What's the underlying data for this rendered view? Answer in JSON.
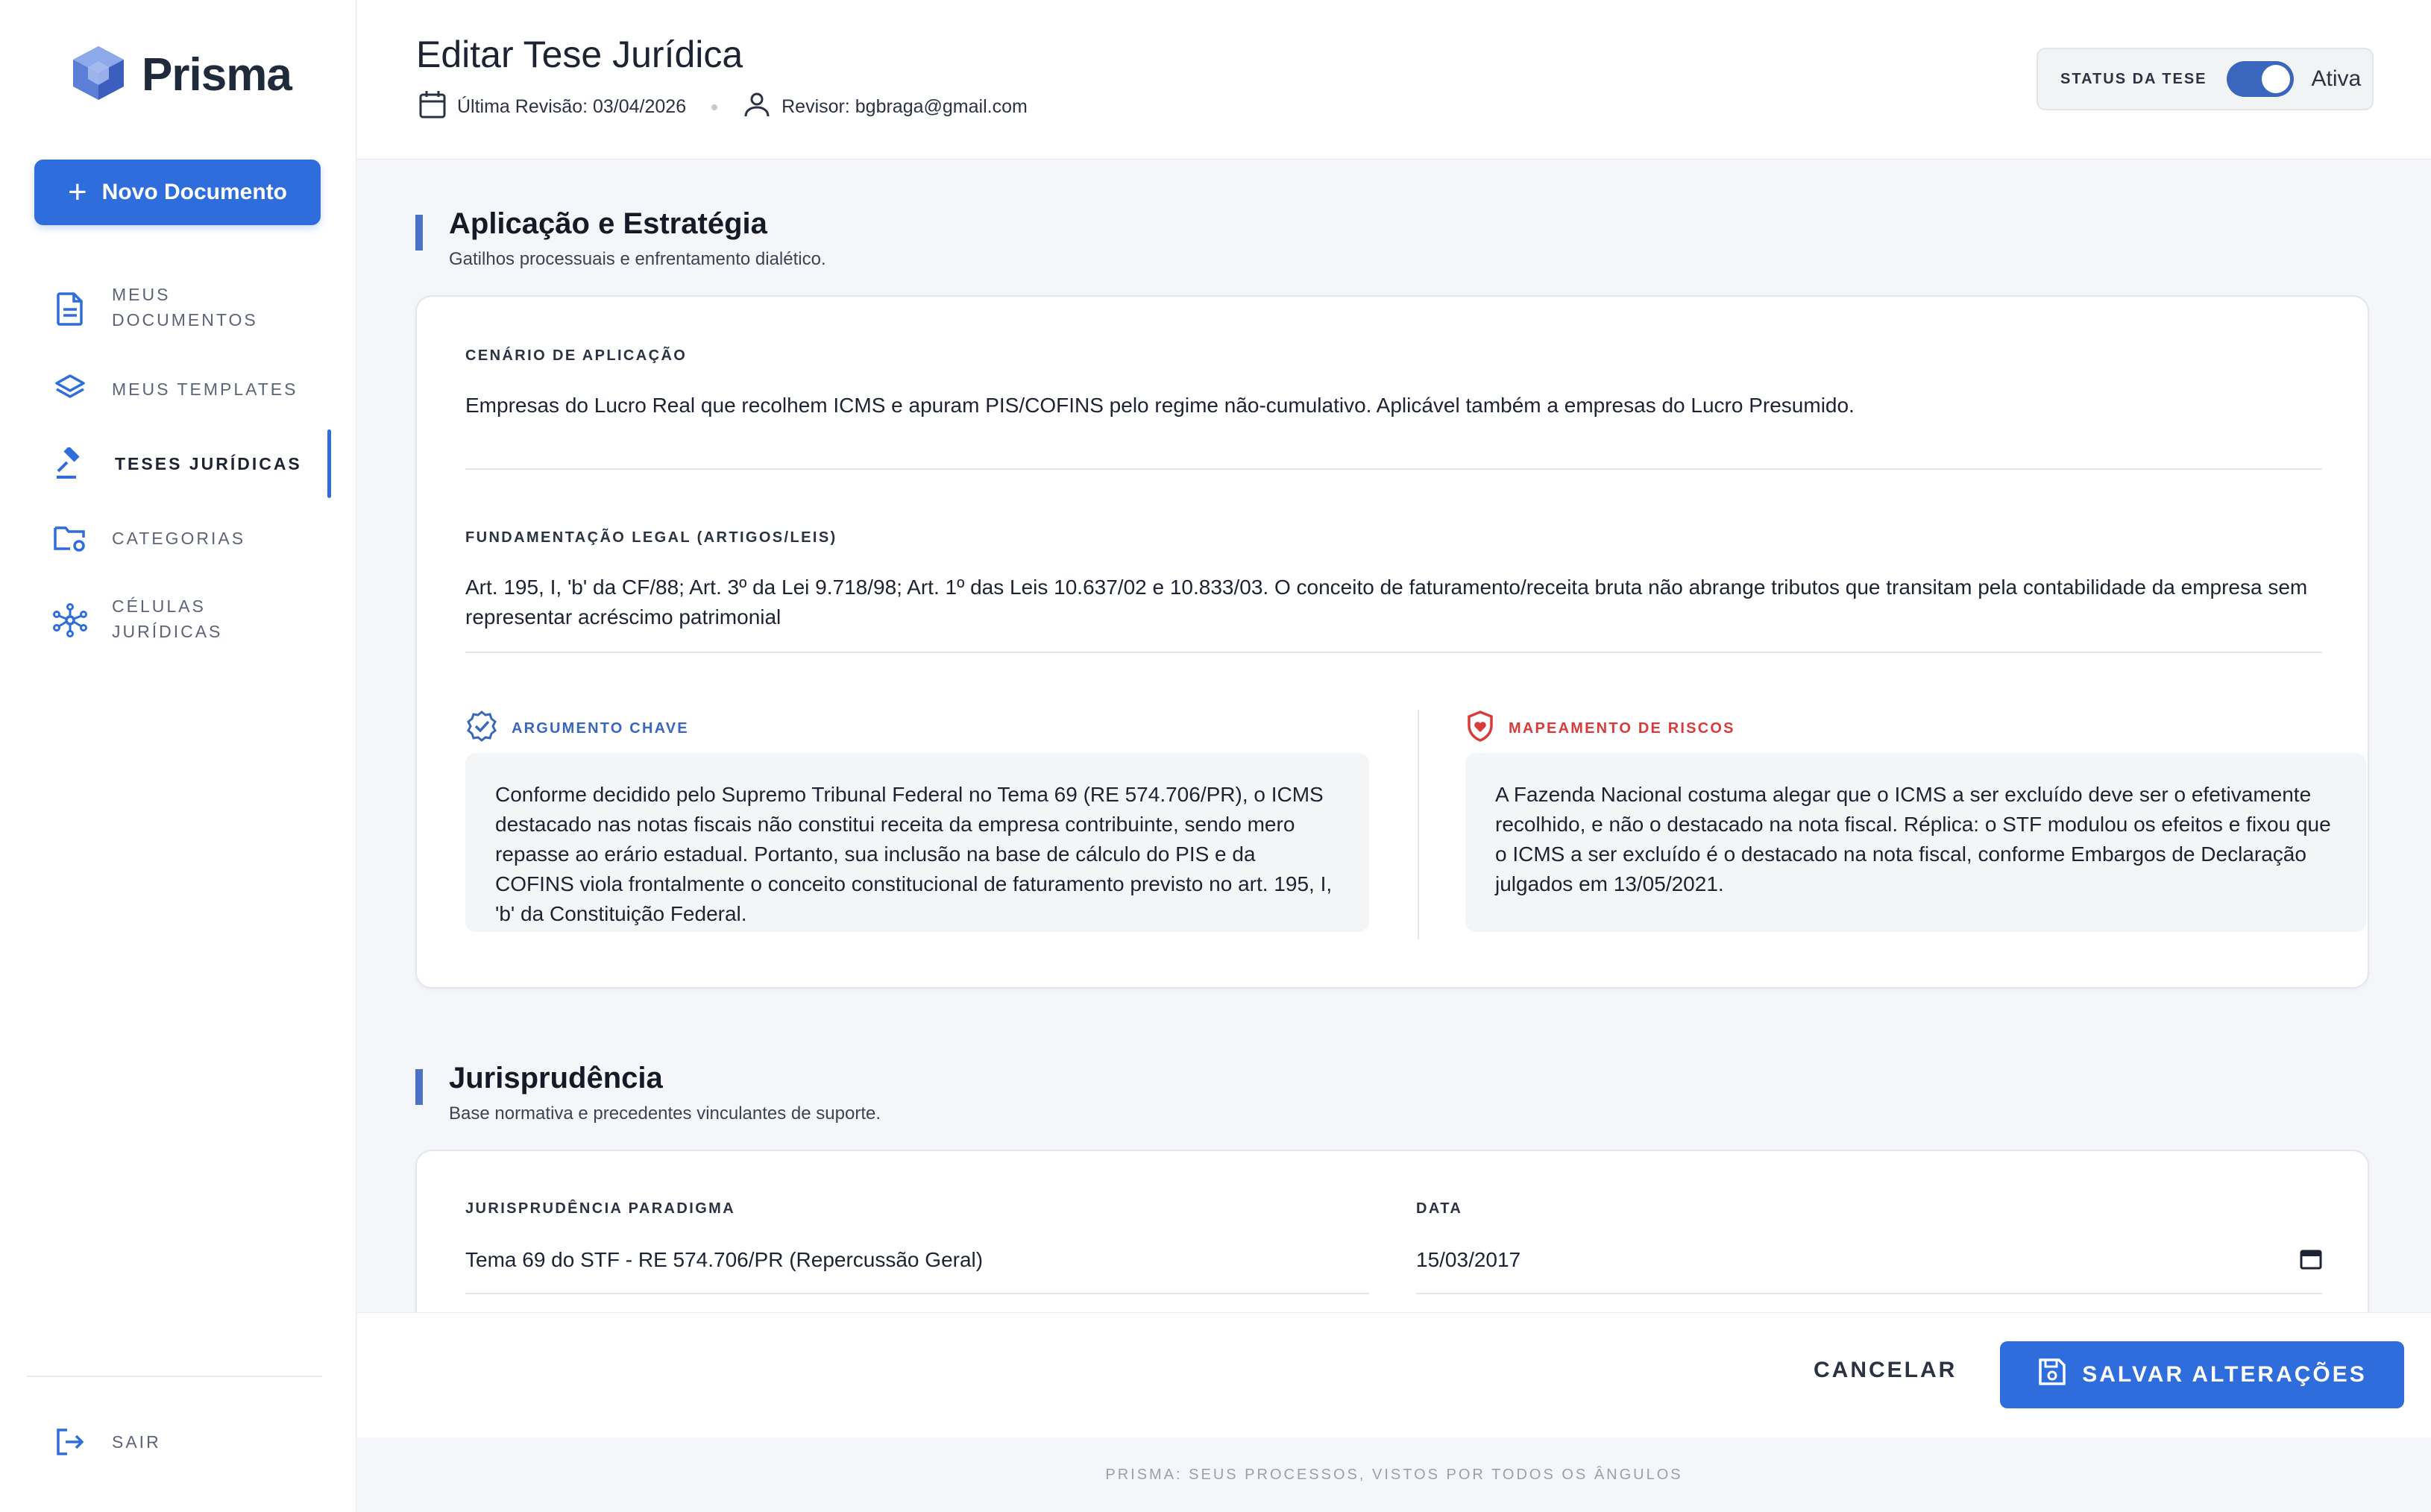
{
  "sidebar": {
    "brand": "Prisma",
    "new_document": "Novo Documento",
    "items": [
      {
        "label": "MEUS\nDOCUMENTOS",
        "icon": "document-icon"
      },
      {
        "label": "MEUS TEMPLATES",
        "icon": "layers-icon"
      },
      {
        "label": "TESES JURÍDICAS",
        "icon": "gavel-icon",
        "active": true
      },
      {
        "label": "CATEGORIAS",
        "icon": "folder-settings-icon"
      },
      {
        "label": "CÉLULAS\nJURÍDICAS",
        "icon": "network-icon"
      }
    ],
    "logout": "SAIR"
  },
  "header": {
    "title": "Editar Tese Jurídica",
    "last_revision": "Última Revisão: 03/04/2026",
    "reviewer": "Revisor: bgbraga@gmail.com",
    "status_label": "STATUS DA TESE",
    "status_value": "Ativa",
    "status_on": true
  },
  "sections": {
    "application": {
      "title": "Aplicação e Estratégia",
      "subtitle": "Gatilhos processuais e enfrentamento dialético.",
      "scenario_label": "CENÁRIO DE APLICAÇÃO",
      "scenario_value": "Empresas do Lucro Real que recolhem ICMS e apuram PIS/COFINS pelo regime não-cumulativo. Aplicável também a empresas do Lucro Presumido.",
      "legal_label": "FUNDAMENTAÇÃO LEGAL (ARTIGOS/LEIS)",
      "legal_value": "Art. 195, I, 'b' da CF/88; Art. 3º da Lei 9.718/98; Art. 1º das Leis 10.637/02 e 10.833/03. O conceito de faturamento/receita bruta não abrange tributos que transitam pela contabilidade da empresa sem representar acréscimo patrimonial",
      "key_argument_label": "ARGUMENTO CHAVE",
      "key_argument_value": "Conforme decidido pelo Supremo Tribunal Federal no Tema 69 (RE 574.706/PR), o ICMS destacado nas notas fiscais não constitui receita da empresa contribuinte, sendo mero repasse ao erário estadual. Portanto, sua inclusão na base de cálculo do PIS e da COFINS viola frontalmente o conceito constitucional de faturamento previsto no art. 195, I, 'b' da Constituição Federal.",
      "risks_label": "MAPEAMENTO DE RISCOS",
      "risks_value": "A Fazenda Nacional costuma alegar que o ICMS a ser excluído deve ser o efetivamente recolhido, e não o destacado na nota fiscal. Réplica: o STF modulou os efeitos e fixou que o ICMS a ser excluído é o destacado na nota fiscal, conforme Embargos de Declaração julgados em 13/05/2021."
    },
    "jurisprudence": {
      "title": "Jurisprudência",
      "subtitle": "Base normativa e precedentes vinculantes de suporte.",
      "paradigm_label": "JURISPRUDÊNCIA PARADIGMA",
      "paradigm_value": "Tema 69 do STF - RE 574.706/PR (Repercussão Geral)",
      "date_label": "DATA",
      "date_value": "15/03/2017"
    }
  },
  "actions": {
    "cancel": "CANCELAR",
    "save": "SALVAR ALTERAÇÕES"
  },
  "footer": "PRISMA: SEUS PROCESSOS, VISTOS POR TODOS OS ÂNGULOS",
  "colors": {
    "primary": "#2f6ddc",
    "accent_blue": "#3a66bd",
    "risk_red": "#d93a3a"
  }
}
